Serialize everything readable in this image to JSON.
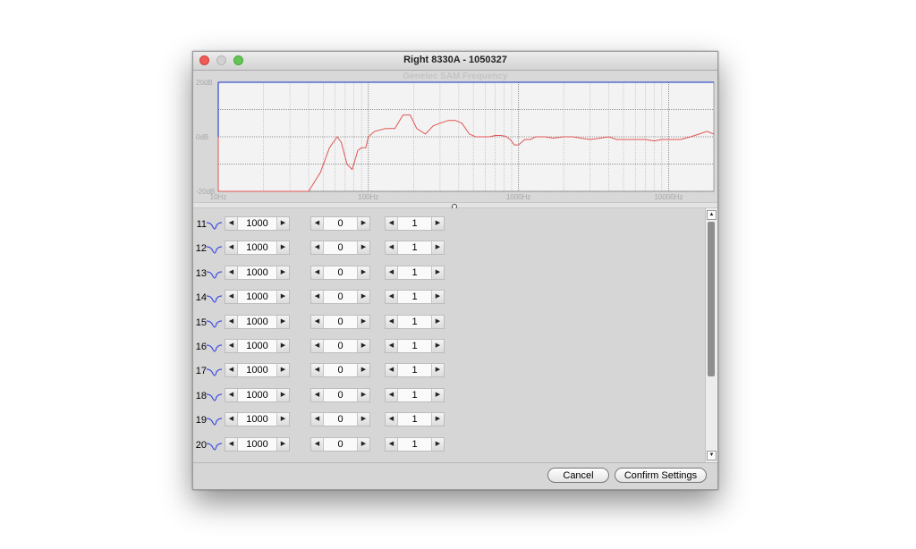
{
  "window": {
    "title": "Right 8330A - 1050327"
  },
  "colors": {
    "curve": "#e05555",
    "flat_line": "#3a55cc",
    "filter_icon": "#3a4ae0",
    "grid_major": "#7a7a7a",
    "grid_minor": "#b0b0b0"
  },
  "chart_data": {
    "type": "line",
    "title": "Genelec SAM Frequency",
    "x_scale": "log",
    "xlim": [
      10,
      20000
    ],
    "ylim": [
      -20,
      20
    ],
    "y_tick_labels": [
      "20dB",
      "0dB",
      "-20dB"
    ],
    "y_ticks": [
      20,
      0,
      -20
    ],
    "x_tick_labels": [
      "10Hz",
      "100Hz",
      "1000Hz",
      "10000Hz"
    ],
    "x_ticks": [
      10,
      100,
      1000,
      10000
    ],
    "grid": true,
    "series": [
      {
        "x": [
          10,
          10,
          20,
          30,
          40,
          48,
          55,
          62,
          66,
          72,
          78,
          85,
          90,
          96,
          100,
          110,
          130,
          150,
          170,
          190,
          210,
          240,
          270,
          300,
          340,
          380,
          420,
          470,
          520,
          580,
          640,
          700,
          760,
          820,
          880,
          940,
          1000,
          1100,
          1200,
          1300,
          1500,
          1700,
          2000,
          2300,
          2600,
          3000,
          3500,
          4000,
          4500,
          5000,
          6000,
          7000,
          8000,
          9000,
          10000,
          12000,
          14000,
          16000,
          18000,
          20000
        ],
        "y": [
          0,
          -20,
          -20,
          -20,
          -20,
          -13,
          -4,
          0,
          -2,
          -10,
          -12,
          -5,
          -4,
          -4,
          0,
          2,
          3,
          3,
          8,
          8,
          3,
          1,
          4,
          5,
          6,
          6,
          5,
          1,
          0,
          0,
          0,
          0.5,
          0.5,
          0.2,
          -1,
          -3,
          -3,
          -1,
          -1,
          0,
          0,
          -0.5,
          0,
          0,
          -0.5,
          -1,
          -0.5,
          0,
          -1,
          -1,
          -1,
          -1,
          -1.5,
          -1,
          -1,
          -1,
          0,
          1,
          2,
          1
        ]
      },
      {
        "x": [
          10,
          20000
        ],
        "y": [
          20,
          20
        ]
      }
    ]
  },
  "filters": {
    "rows": [
      {
        "index": "11",
        "frequency": "1000",
        "gain": "0",
        "q": "1"
      },
      {
        "index": "12",
        "frequency": "1000",
        "gain": "0",
        "q": "1"
      },
      {
        "index": "13",
        "frequency": "1000",
        "gain": "0",
        "q": "1"
      },
      {
        "index": "14",
        "frequency": "1000",
        "gain": "0",
        "q": "1"
      },
      {
        "index": "15",
        "frequency": "1000",
        "gain": "0",
        "q": "1"
      },
      {
        "index": "16",
        "frequency": "1000",
        "gain": "0",
        "q": "1"
      },
      {
        "index": "17",
        "frequency": "1000",
        "gain": "0",
        "q": "1"
      },
      {
        "index": "18",
        "frequency": "1000",
        "gain": "0",
        "q": "1"
      },
      {
        "index": "19",
        "frequency": "1000",
        "gain": "0",
        "q": "1"
      },
      {
        "index": "20",
        "frequency": "1000",
        "gain": "0",
        "q": "1"
      }
    ]
  },
  "buttons": {
    "cancel": "Cancel",
    "confirm": "Confirm Settings"
  },
  "icons": {
    "decrement": "arrow-left-icon",
    "increment": "arrow-right-icon",
    "filter": "notch-filter-icon"
  }
}
